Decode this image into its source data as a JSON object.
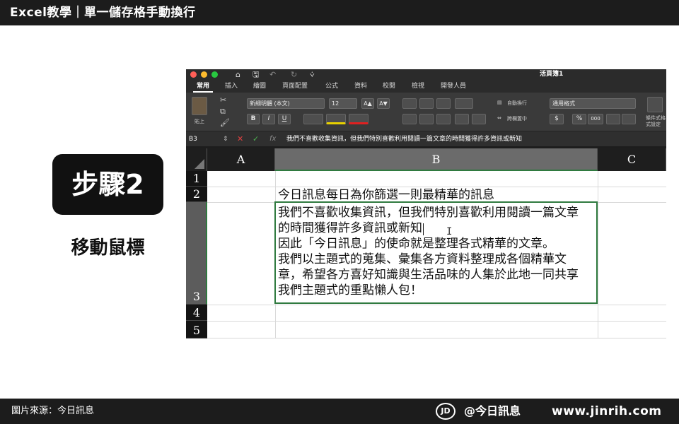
{
  "header": {
    "title": "Excel教學｜單一儲存格手動換行"
  },
  "step": {
    "badge": "步驟2",
    "caption": "移動鼠標"
  },
  "footer": {
    "source": "圖片來源：今日訊息",
    "logo": "JD",
    "brand": "@今日訊息",
    "site": "www.jinrih.com"
  },
  "excel": {
    "workbook_title": "活頁簿1",
    "traffic_lights": [
      "#ff5f57",
      "#febc2e",
      "#28c840"
    ],
    "quick_access": {
      "home": "⌂",
      "save": "🖫",
      "undo": "↶",
      "redo": "↻",
      "more": "⩒"
    },
    "tabs": [
      "常用",
      "插入",
      "繪圖",
      "頁面配置",
      "公式",
      "資料",
      "校閱",
      "檢視",
      "開發人員"
    ],
    "active_tab": "常用",
    "ribbon": {
      "paste_label": "貼上",
      "font_name": "新細明體 (本文)",
      "font_size": "12",
      "grow_font": "A▲",
      "shrink_font": "A▼",
      "bold": "B",
      "italic": "I",
      "underline": "U",
      "wrap_text": "自動換行",
      "merge_center": "跨欄置中",
      "number_format": "通用格式",
      "currency": "$",
      "percent": "%",
      "comma": "000",
      "conditional_format": "條件式格式設定"
    },
    "formula_bar": {
      "cell_ref": "B3",
      "cancel": "✕",
      "confirm": "✓",
      "fx": "fx",
      "content": "我們不喜歡收集資訊，但我們特別喜歡利用閱讀一篇文章的時間獲得許多資訊或新知"
    },
    "columns": [
      "A",
      "B",
      "C"
    ],
    "selected_column": "B",
    "rows": [
      "1",
      "2",
      "3",
      "4",
      "5"
    ],
    "selected_row": "3",
    "cells": {
      "B2": "今日訊息每日為你篩選一則最精華的訊息",
      "B3_lines": [
        "我們不喜歡收集資訊，但我們特別喜歡利用閱讀一篇文章",
        "的時間獲得許多資訊或新知",
        "因此「今日訊息」的使命就是整理各式精華的文章。",
        "我們以主題式的蒐集、彙集各方資料整理成各個精華文",
        "章，希望各方喜好知識與生活品味的人集於此地一同共享",
        "我們主題式的重點懶人包！"
      ]
    },
    "mouse_cursor": "I",
    "accent_color": "#2f7a3f"
  }
}
